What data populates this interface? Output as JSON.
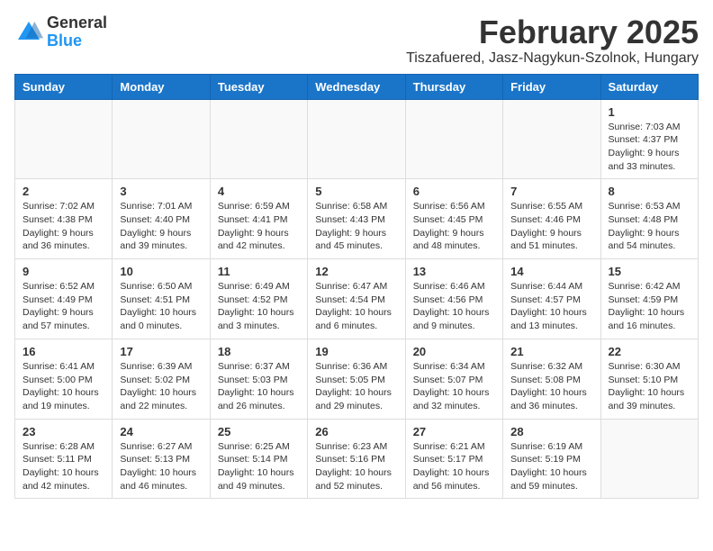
{
  "logo": {
    "general": "General",
    "blue": "Blue"
  },
  "title": "February 2025",
  "subtitle": "Tiszafuered, Jasz-Nagykun-Szolnok, Hungary",
  "headers": [
    "Sunday",
    "Monday",
    "Tuesday",
    "Wednesday",
    "Thursday",
    "Friday",
    "Saturday"
  ],
  "weeks": [
    [
      {
        "day": "",
        "info": ""
      },
      {
        "day": "",
        "info": ""
      },
      {
        "day": "",
        "info": ""
      },
      {
        "day": "",
        "info": ""
      },
      {
        "day": "",
        "info": ""
      },
      {
        "day": "",
        "info": ""
      },
      {
        "day": "1",
        "info": "Sunrise: 7:03 AM\nSunset: 4:37 PM\nDaylight: 9 hours\nand 33 minutes."
      }
    ],
    [
      {
        "day": "2",
        "info": "Sunrise: 7:02 AM\nSunset: 4:38 PM\nDaylight: 9 hours\nand 36 minutes."
      },
      {
        "day": "3",
        "info": "Sunrise: 7:01 AM\nSunset: 4:40 PM\nDaylight: 9 hours\nand 39 minutes."
      },
      {
        "day": "4",
        "info": "Sunrise: 6:59 AM\nSunset: 4:41 PM\nDaylight: 9 hours\nand 42 minutes."
      },
      {
        "day": "5",
        "info": "Sunrise: 6:58 AM\nSunset: 4:43 PM\nDaylight: 9 hours\nand 45 minutes."
      },
      {
        "day": "6",
        "info": "Sunrise: 6:56 AM\nSunset: 4:45 PM\nDaylight: 9 hours\nand 48 minutes."
      },
      {
        "day": "7",
        "info": "Sunrise: 6:55 AM\nSunset: 4:46 PM\nDaylight: 9 hours\nand 51 minutes."
      },
      {
        "day": "8",
        "info": "Sunrise: 6:53 AM\nSunset: 4:48 PM\nDaylight: 9 hours\nand 54 minutes."
      }
    ],
    [
      {
        "day": "9",
        "info": "Sunrise: 6:52 AM\nSunset: 4:49 PM\nDaylight: 9 hours\nand 57 minutes."
      },
      {
        "day": "10",
        "info": "Sunrise: 6:50 AM\nSunset: 4:51 PM\nDaylight: 10 hours\nand 0 minutes."
      },
      {
        "day": "11",
        "info": "Sunrise: 6:49 AM\nSunset: 4:52 PM\nDaylight: 10 hours\nand 3 minutes."
      },
      {
        "day": "12",
        "info": "Sunrise: 6:47 AM\nSunset: 4:54 PM\nDaylight: 10 hours\nand 6 minutes."
      },
      {
        "day": "13",
        "info": "Sunrise: 6:46 AM\nSunset: 4:56 PM\nDaylight: 10 hours\nand 9 minutes."
      },
      {
        "day": "14",
        "info": "Sunrise: 6:44 AM\nSunset: 4:57 PM\nDaylight: 10 hours\nand 13 minutes."
      },
      {
        "day": "15",
        "info": "Sunrise: 6:42 AM\nSunset: 4:59 PM\nDaylight: 10 hours\nand 16 minutes."
      }
    ],
    [
      {
        "day": "16",
        "info": "Sunrise: 6:41 AM\nSunset: 5:00 PM\nDaylight: 10 hours\nand 19 minutes."
      },
      {
        "day": "17",
        "info": "Sunrise: 6:39 AM\nSunset: 5:02 PM\nDaylight: 10 hours\nand 22 minutes."
      },
      {
        "day": "18",
        "info": "Sunrise: 6:37 AM\nSunset: 5:03 PM\nDaylight: 10 hours\nand 26 minutes."
      },
      {
        "day": "19",
        "info": "Sunrise: 6:36 AM\nSunset: 5:05 PM\nDaylight: 10 hours\nand 29 minutes."
      },
      {
        "day": "20",
        "info": "Sunrise: 6:34 AM\nSunset: 5:07 PM\nDaylight: 10 hours\nand 32 minutes."
      },
      {
        "day": "21",
        "info": "Sunrise: 6:32 AM\nSunset: 5:08 PM\nDaylight: 10 hours\nand 36 minutes."
      },
      {
        "day": "22",
        "info": "Sunrise: 6:30 AM\nSunset: 5:10 PM\nDaylight: 10 hours\nand 39 minutes."
      }
    ],
    [
      {
        "day": "23",
        "info": "Sunrise: 6:28 AM\nSunset: 5:11 PM\nDaylight: 10 hours\nand 42 minutes."
      },
      {
        "day": "24",
        "info": "Sunrise: 6:27 AM\nSunset: 5:13 PM\nDaylight: 10 hours\nand 46 minutes."
      },
      {
        "day": "25",
        "info": "Sunrise: 6:25 AM\nSunset: 5:14 PM\nDaylight: 10 hours\nand 49 minutes."
      },
      {
        "day": "26",
        "info": "Sunrise: 6:23 AM\nSunset: 5:16 PM\nDaylight: 10 hours\nand 52 minutes."
      },
      {
        "day": "27",
        "info": "Sunrise: 6:21 AM\nSunset: 5:17 PM\nDaylight: 10 hours\nand 56 minutes."
      },
      {
        "day": "28",
        "info": "Sunrise: 6:19 AM\nSunset: 5:19 PM\nDaylight: 10 hours\nand 59 minutes."
      },
      {
        "day": "",
        "info": ""
      }
    ]
  ]
}
